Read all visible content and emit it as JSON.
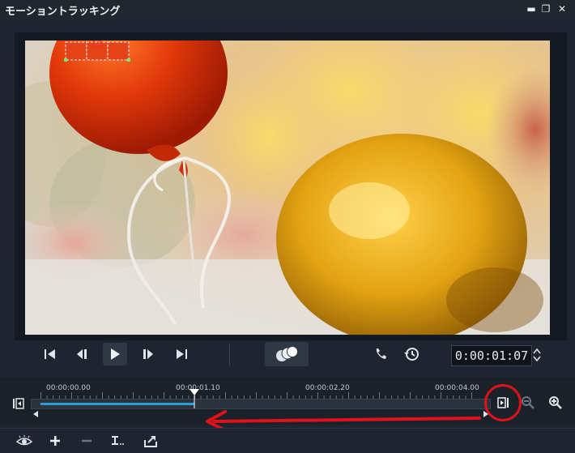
{
  "window": {
    "title": "モーショントラッキング",
    "min_glyph": "▬",
    "restore_glyph": "❐",
    "close_glyph": "✕"
  },
  "player": {
    "timecode": "0:00:01:07",
    "icons": [
      "go-to-start-icon",
      "previous-frame-icon",
      "play-icon",
      "next-frame-icon",
      "go-to-end-icon",
      "track-multiple-icon",
      "track-call-icon",
      "history-icon"
    ]
  },
  "timeline": {
    "ruler_labels": [
      {
        "text": "00:00:00.00",
        "pos": 0.0
      },
      {
        "text": "00:00:01.10",
        "pos": 0.3125
      },
      {
        "text": "00:00:02.20",
        "pos": 0.625
      },
      {
        "text": "00:00:04.00",
        "pos": 0.9375
      }
    ],
    "playhead_label": "00:00:01.10",
    "progress_fraction": 0.34
  },
  "annotation": {
    "color": "#e0111b"
  },
  "bottom_toolbar": {
    "icons": [
      "view-icon",
      "add-icon",
      "remove-icon",
      "tracking-type-icon",
      "export-icon"
    ]
  }
}
